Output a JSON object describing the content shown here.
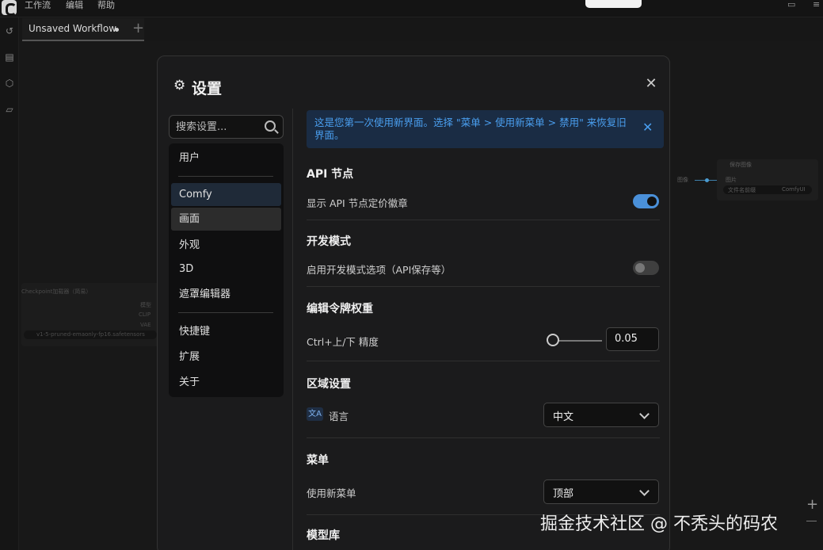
{
  "menubar": {
    "items": [
      "工作流",
      "编辑",
      "帮助"
    ]
  },
  "tabs": {
    "active_label": "Unsaved Workflow",
    "add_label": "+"
  },
  "canvas": {
    "node_save_title": "保存图像",
    "node_save_input": "图片",
    "node_save_prefix_label": "文件名前缀",
    "node_save_prefix_value": "ComfyUI",
    "link_label": "图像",
    "node_ckpt_title": "Checkpoint加载器（简易）",
    "node_ckpt_outputs": [
      "模型",
      "CLIP",
      "VAE"
    ],
    "node_ckpt_value": "v1-5-pruned-emaonly-fp16.safetensors"
  },
  "dialog": {
    "title": "设置",
    "search_placeholder": "搜索设置...",
    "nav": [
      {
        "label": "用户"
      },
      {
        "label": "Comfy"
      },
      {
        "label": "画面"
      },
      {
        "label": "外观"
      },
      {
        "label": "3D"
      },
      {
        "label": "遮罩编辑器"
      },
      {
        "label": "快捷键"
      },
      {
        "label": "扩展"
      },
      {
        "label": "关于"
      }
    ],
    "notice": "这是您第一次使用新界面。选择 \"菜单 > 使用新菜单 > 禁用\" 来恢复旧界面。",
    "sections": {
      "api": {
        "title": "API 节点",
        "setting": "显示 API 节点定价徽章",
        "enabled": true
      },
      "dev": {
        "title": "开发模式",
        "setting": "启用开发模式选项（API保存等）",
        "enabled": false
      },
      "token": {
        "title": "编辑令牌权重",
        "setting": "Ctrl+上/下 精度",
        "value": "0.05",
        "slider_fraction": 0.0
      },
      "locale": {
        "title": "区域设置",
        "setting": "语言",
        "value": "中文",
        "icon_glyph": "文A"
      },
      "menu": {
        "title": "菜单",
        "setting": "使用新菜单",
        "value": "顶部"
      },
      "model": {
        "title": "模型库"
      }
    }
  },
  "watermark": "掘金技术社区 @ 不秃头的码农",
  "colors": {
    "accent": "#4a90d9",
    "notice_bg": "#1a2c44",
    "notice_text": "#4a9ff0",
    "dialog_bg": "#1b1b1c"
  }
}
